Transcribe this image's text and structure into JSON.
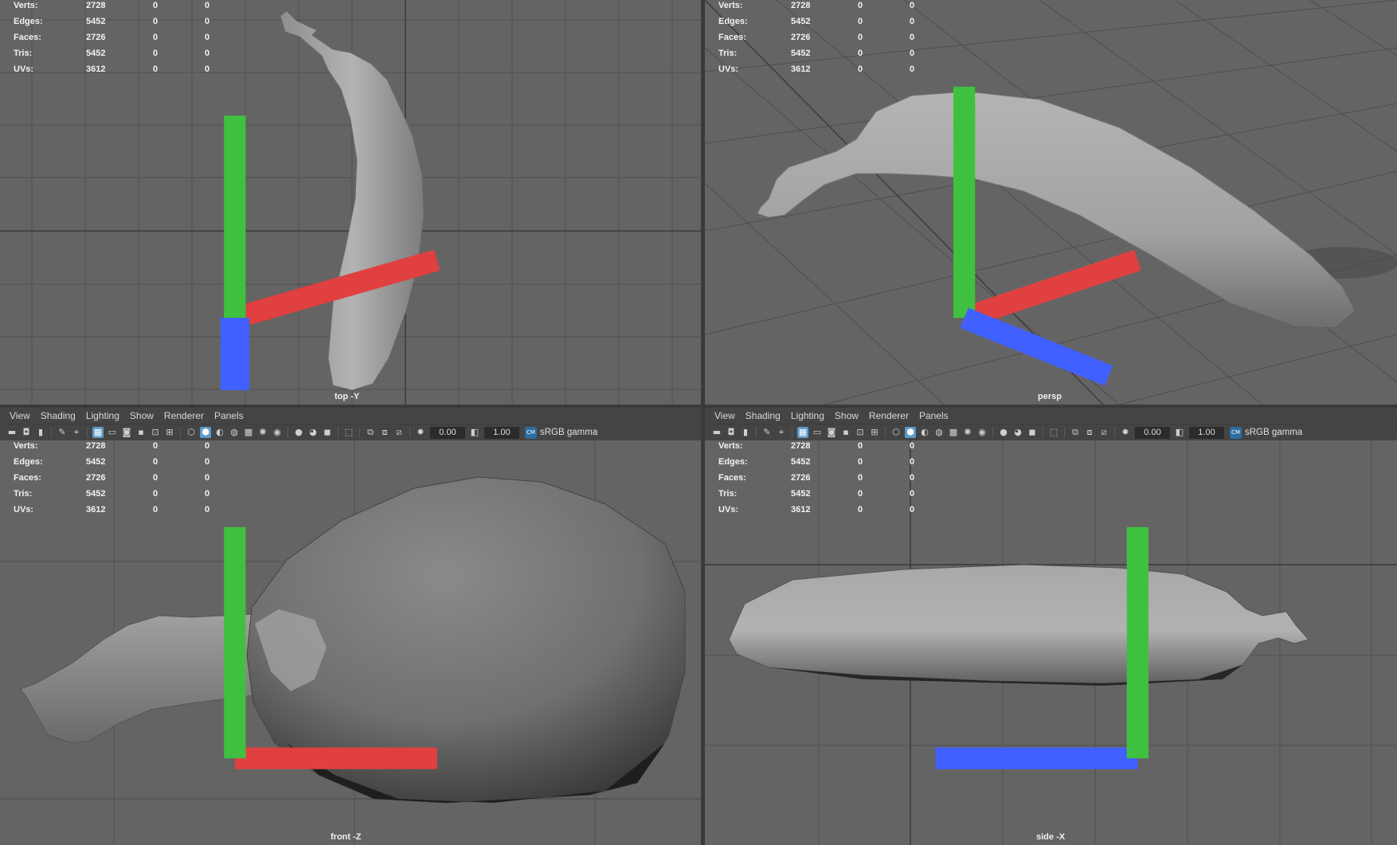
{
  "menu": [
    "View",
    "Shading",
    "Lighting",
    "Show",
    "Renderer",
    "Panels"
  ],
  "toolbar": {
    "exposure": "0.00",
    "gamma": "1.00",
    "colorspace_icon": "CM",
    "colorspace": "sRGB gamma",
    "icons": [
      "camera-icon",
      "camera-attr-icon",
      "bookmark-icon",
      "image-plane-icon",
      "grid-icon",
      "film-gate-icon",
      "resolution-gate-icon",
      "wireframe-icon",
      "smooth-shade-icon",
      "xray-icon",
      "lighting-icon",
      "isolate-icon",
      "exposure-icon",
      "gamma-icon"
    ]
  },
  "hud": [
    {
      "label": "Verts:",
      "v1": "2728",
      "v2": "0",
      "v3": "0"
    },
    {
      "label": "Edges:",
      "v1": "5452",
      "v2": "0",
      "v3": "0"
    },
    {
      "label": "Faces:",
      "v1": "2726",
      "v2": "0",
      "v3": "0"
    },
    {
      "label": "Tris:",
      "v1": "5452",
      "v2": "0",
      "v3": "0"
    },
    {
      "label": "UVs:",
      "v1": "3612",
      "v2": "0",
      "v3": "0"
    }
  ],
  "panes": {
    "top": {
      "camera": "top -Y"
    },
    "persp": {
      "camera": "persp"
    },
    "front": {
      "camera": "front -Z"
    },
    "side": {
      "camera": "side -X"
    }
  },
  "colors": {
    "viewport_bg": "#646464",
    "grid": "#4d4d4d",
    "mesh": "#a6a6a6",
    "toolbar_bg": "#444444",
    "active": "#5d9bc8"
  }
}
